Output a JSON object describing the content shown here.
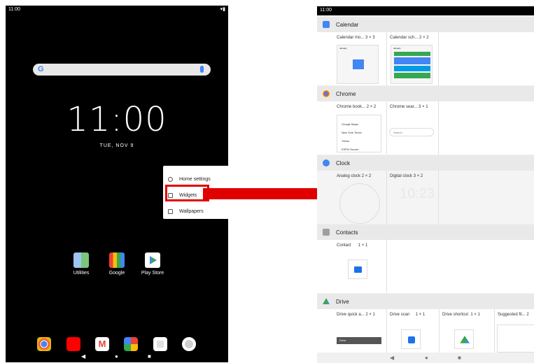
{
  "left_screen": {
    "status_time": "11:00",
    "status_icons": "▾▮",
    "search_logo": "G",
    "clock": "11:00",
    "date": "TUE, NOV 9",
    "popup": {
      "home_settings": "Home settings",
      "widgets": "Widgets",
      "wallpapers": "Wallpapers"
    },
    "apps": [
      "Utilities",
      "Google",
      "Play Store"
    ],
    "dock": [
      "chrome-icon",
      "youtube-icon",
      "gmail-icon",
      "photos-icon",
      "camera-icon",
      "settings-icon"
    ],
    "nav": {
      "back": "◀",
      "home": "●",
      "recents": "■"
    }
  },
  "right_screen": {
    "status_time": "11:00",
    "sections": {
      "calendar": {
        "title": "Calendar",
        "widgets": [
          {
            "name": "Calendar mo...",
            "size": "3 × 3"
          },
          {
            "name": "Calendar sch...",
            "size": "2 × 2"
          }
        ],
        "preview_month": "January",
        "preview_schedule_title": "January"
      },
      "chrome": {
        "title": "Chrome",
        "widgets": [
          {
            "name": "Chrome book...",
            "size": "2 × 2"
          },
          {
            "name": "Chrome sear...",
            "size": "3 × 1"
          }
        ],
        "bookmarks": [
          "Google Maps",
          "New York Times",
          "Yahoo",
          "ESPN Soccer"
        ],
        "search_placeholder": "Search"
      },
      "clock": {
        "title": "Clock",
        "widgets": [
          {
            "name": "Analog clock",
            "size": "2 × 2"
          },
          {
            "name": "Digital clock",
            "size": "3 × 2"
          }
        ],
        "digital_time": "10:23"
      },
      "contacts": {
        "title": "Contacts",
        "widgets": [
          {
            "name": "Contact",
            "size": "1 × 1"
          }
        ]
      },
      "drive": {
        "title": "Drive",
        "widgets": [
          {
            "name": "Drive quick a...",
            "size": "2 × 1"
          },
          {
            "name": "Drive scan",
            "size": "1 × 1"
          },
          {
            "name": "Drive shortcut",
            "size": "1 × 1"
          },
          {
            "name": "Suggested fil...",
            "size": "2"
          }
        ],
        "quick_label": "Drive"
      }
    },
    "nav": {
      "back": "◀",
      "home": "●",
      "recents": "■"
    }
  },
  "colors": {
    "highlight": "#e00000",
    "google_blue": "#4285f4",
    "header_bg": "#e9e9e9"
  }
}
